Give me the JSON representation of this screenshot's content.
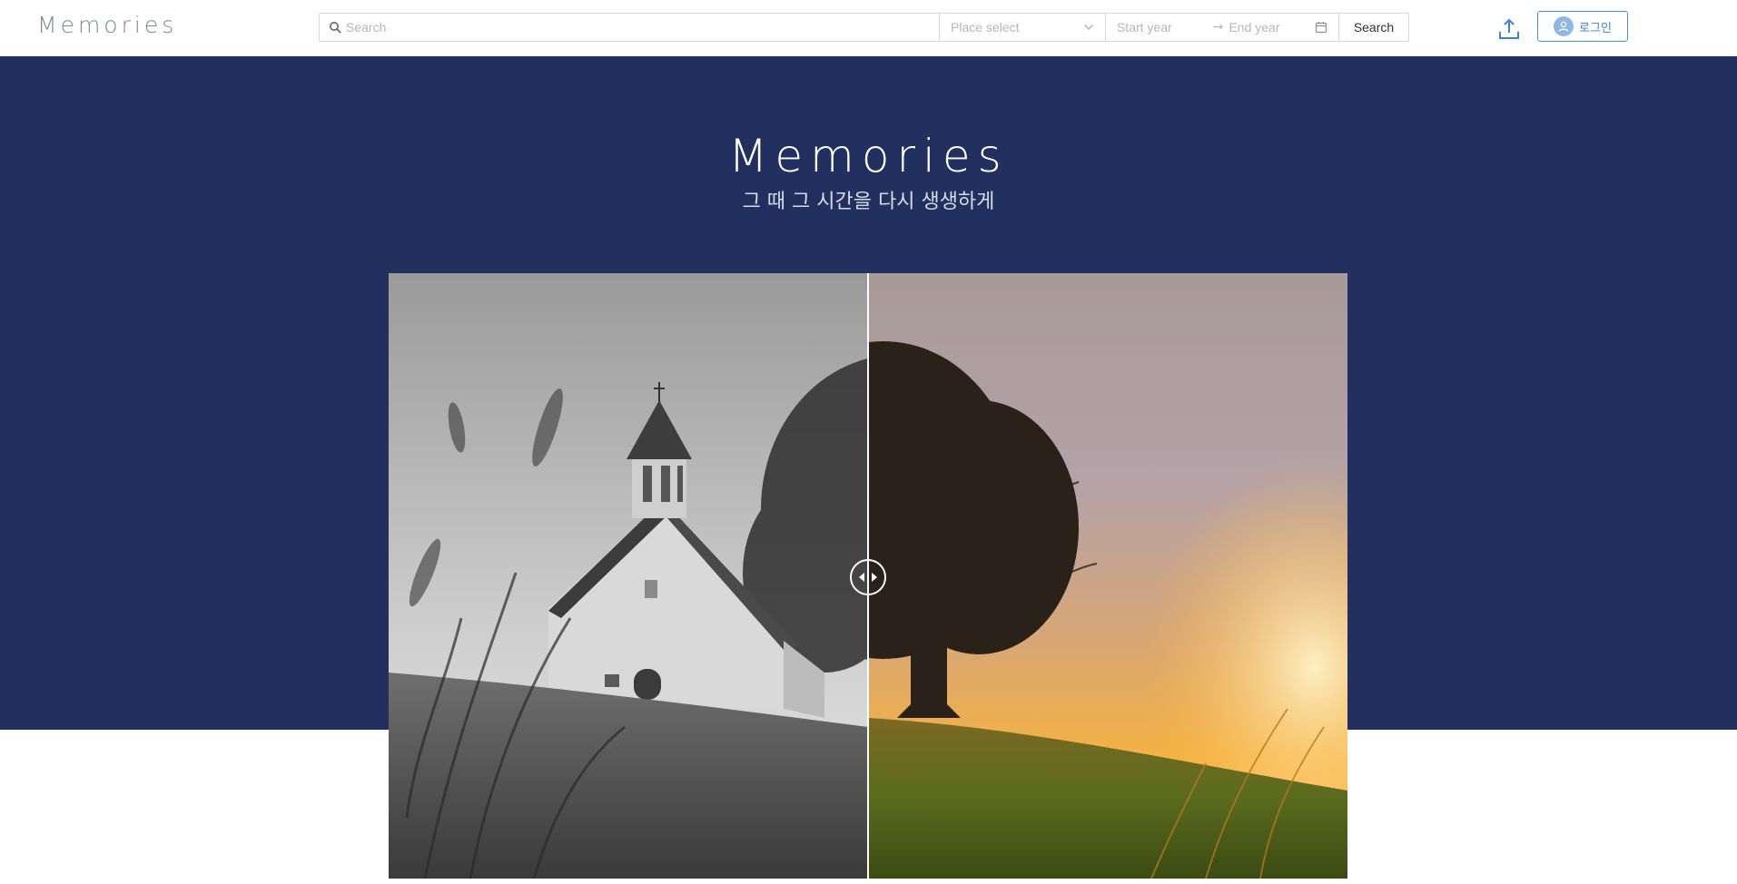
{
  "header": {
    "logo": "Memories",
    "search": {
      "placeholder": "Search",
      "value": ""
    },
    "place_select": {
      "placeholder": "Place select"
    },
    "year_range": {
      "start_placeholder": "Start year",
      "end_placeholder": "End year"
    },
    "search_button": "Search",
    "upload_icon": "upload-icon",
    "login_button": "로그인"
  },
  "hero": {
    "title": "Memories",
    "subtitle": "그 때 그 시간을 다시 생생하게",
    "background": "#223060",
    "compare_slider": {
      "level": 0.5
    }
  },
  "colors": {
    "accent": "#4a90d9",
    "hero_bg": "#223060",
    "logo": "#7f8592"
  }
}
